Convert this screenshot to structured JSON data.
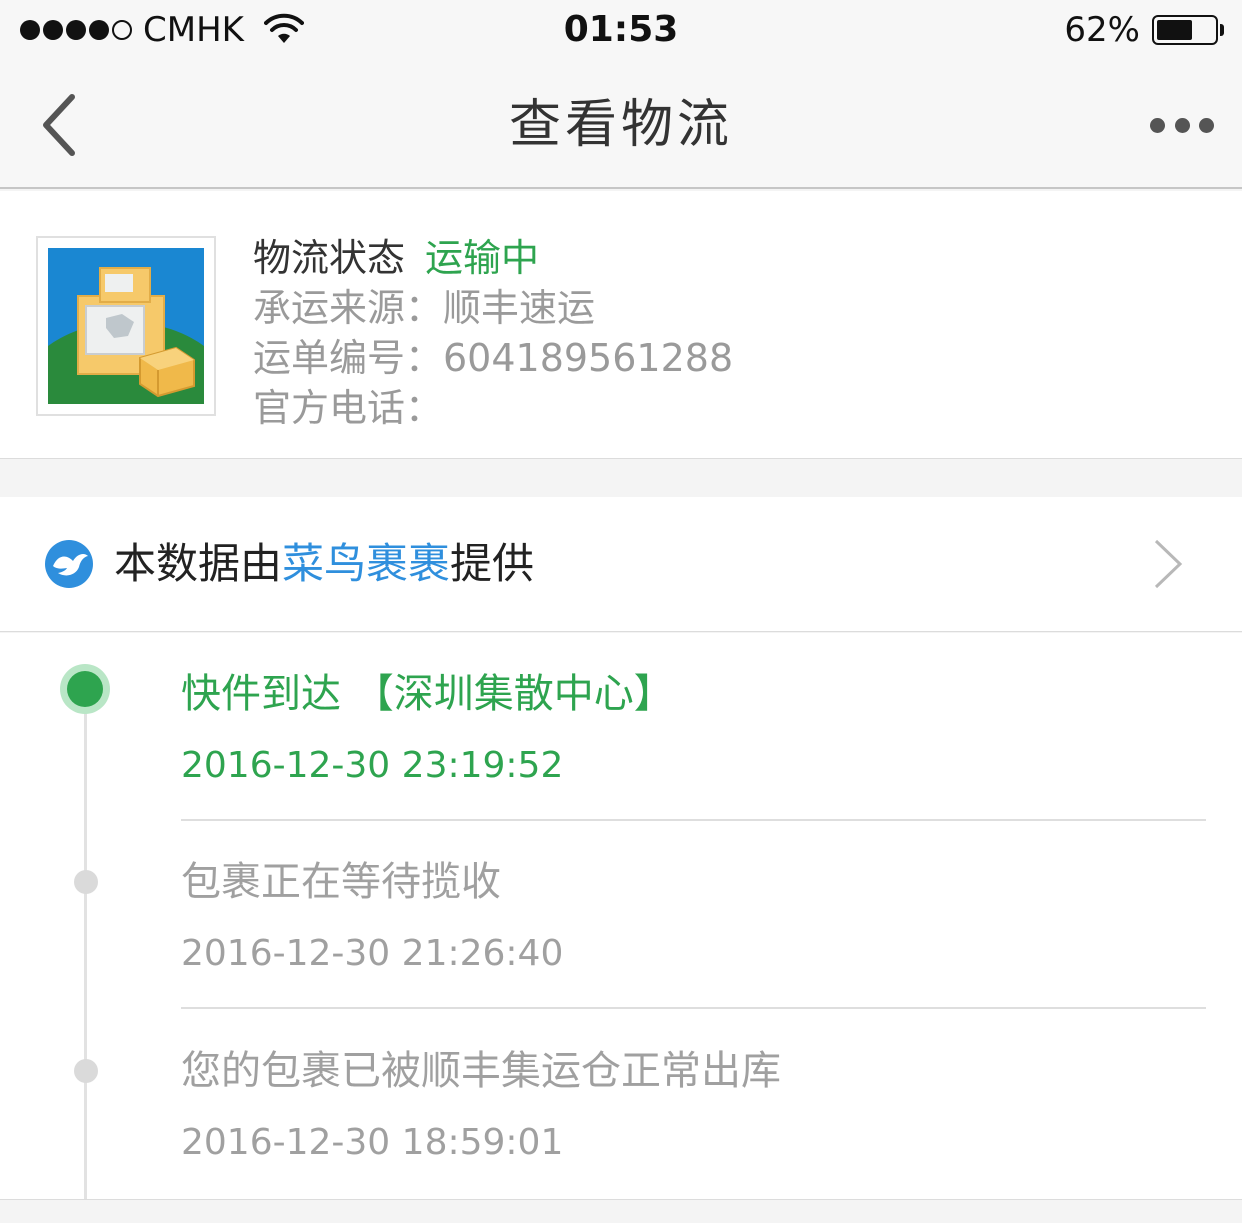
{
  "status_bar": {
    "carrier": "CMHK",
    "time": "01:53",
    "battery_percent": "62%",
    "battery_level": 0.62,
    "signal_bars": 4,
    "signal_max": 5
  },
  "nav": {
    "title": "查看物流",
    "back_icon": "chevron-left-icon",
    "more_icon": "more-dots-icon"
  },
  "logistics": {
    "status_label": "物流状态",
    "status_value": "运输中",
    "carrier_line": "承运来源：顺丰速运",
    "tracking_line": "运单编号：604189561288",
    "phone_line": "官方电话："
  },
  "provider": {
    "prefix": "本数据由",
    "link": "菜鸟裹裹",
    "suffix": "提供"
  },
  "timeline": [
    {
      "title": "快件到达 【深圳集散中心】",
      "time": "2016-12-30 23:19:52",
      "active": true
    },
    {
      "title": "包裹正在等待揽收",
      "time": "2016-12-30 21:26:40",
      "active": false
    },
    {
      "title": "您的包裹已被顺丰集运仓正常出库",
      "time": "2016-12-30 18:59:01",
      "active": false
    }
  ],
  "colors": {
    "accent_green": "#2ea44f",
    "link_blue": "#2f8fdd"
  }
}
